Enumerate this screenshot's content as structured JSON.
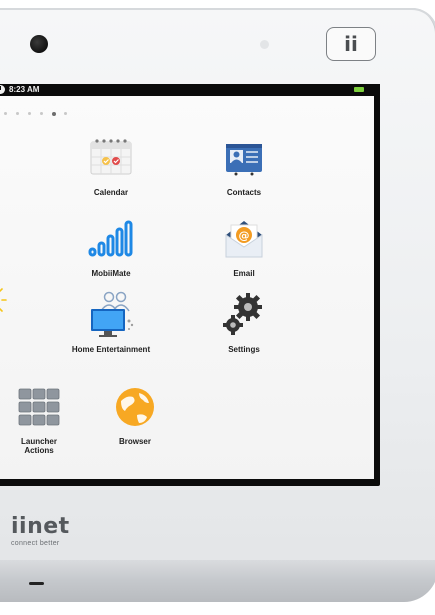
{
  "status_bar": {
    "time": "8:23 AM"
  },
  "hardware": {
    "home_button_label": "ii",
    "brand_name": "iinet",
    "brand_tagline": "connect better"
  },
  "pager": {
    "count": 7,
    "active_index": 5
  },
  "apps": {
    "calendar": {
      "label": "Calendar",
      "icon": "calendar-icon"
    },
    "contacts": {
      "label": "Contacts",
      "icon": "contacts-icon"
    },
    "mobiimate": {
      "label": "MobiiMate",
      "icon": "signal-bars-icon"
    },
    "email": {
      "label": "Email",
      "icon": "email-icon"
    },
    "home_entertainment": {
      "label": "Home Entertainment",
      "icon": "home-entertainment-icon"
    },
    "settings": {
      "label": "Settings",
      "icon": "gears-icon"
    },
    "launcher_actions": {
      "label": "Launcher Actions",
      "icon": "grid-icon"
    },
    "browser": {
      "label": "Browser",
      "icon": "globe-icon"
    }
  },
  "colors": {
    "bezel": "#0b0b0b",
    "battery": "#7ccf3c",
    "signal_blue": "#1e88e5"
  }
}
